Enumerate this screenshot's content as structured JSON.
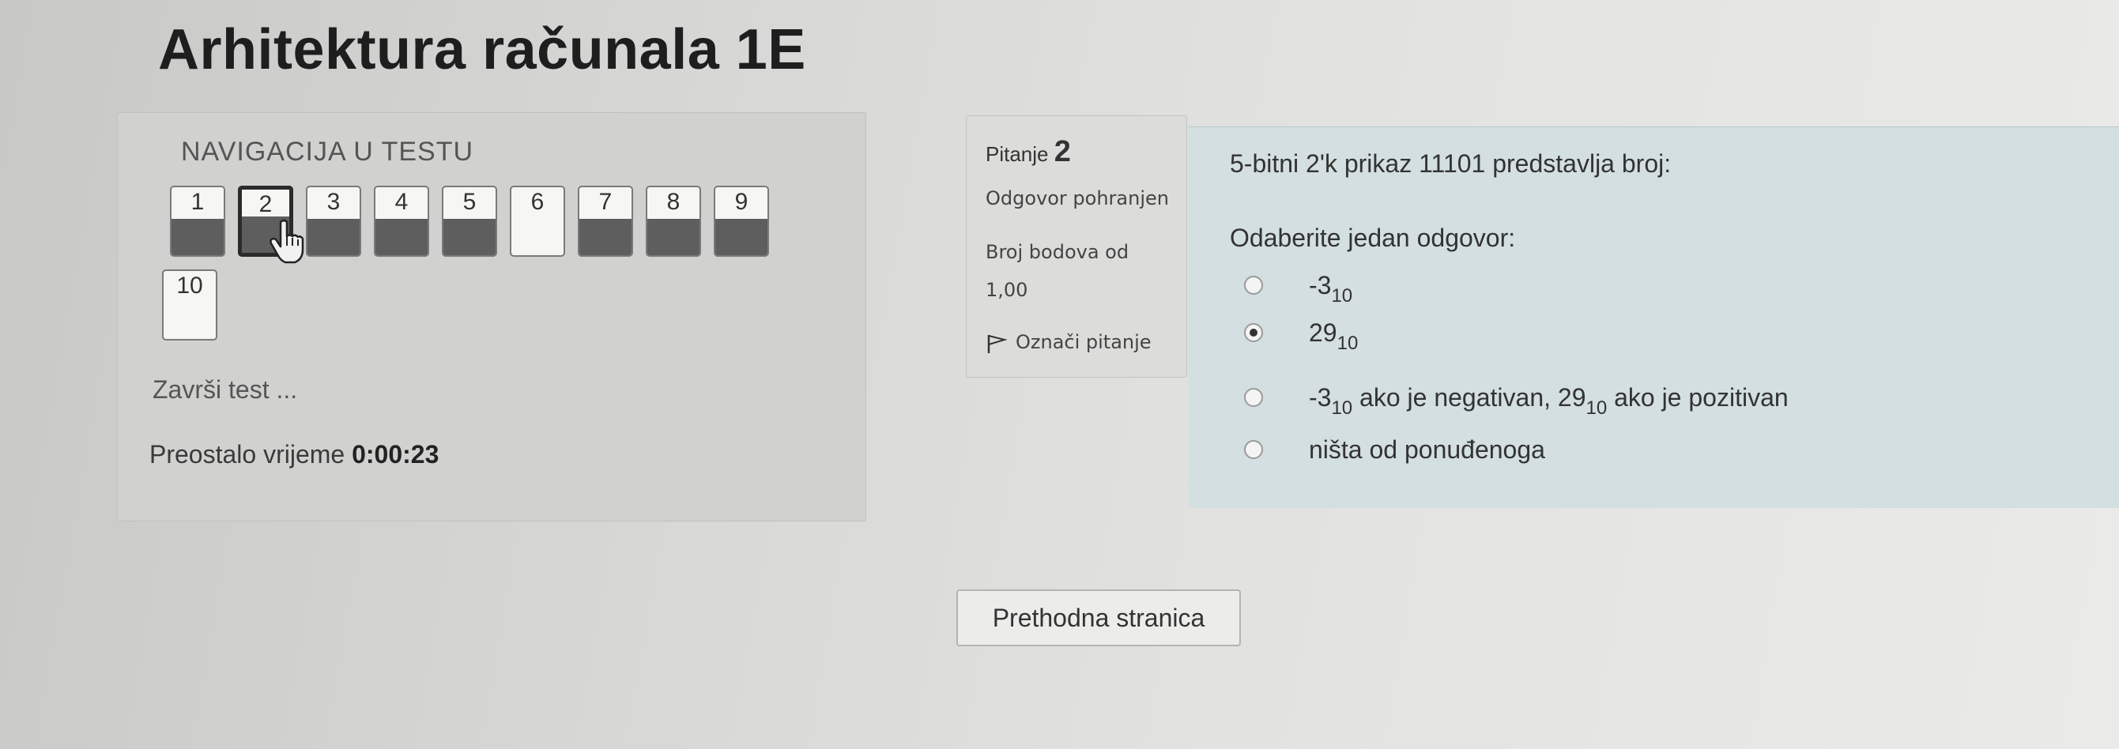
{
  "course": {
    "title": "Arhitektura računala 1E"
  },
  "navigation": {
    "heading": "NAVIGACIJA U TESTU",
    "questions": [
      {
        "label": "1",
        "answered": true,
        "current": false
      },
      {
        "label": "2",
        "answered": true,
        "current": true
      },
      {
        "label": "3",
        "answered": true,
        "current": false
      },
      {
        "label": "4",
        "answered": true,
        "current": false
      },
      {
        "label": "5",
        "answered": true,
        "current": false
      },
      {
        "label": "6",
        "answered": false,
        "current": false
      },
      {
        "label": "7",
        "answered": true,
        "current": false
      },
      {
        "label": "8",
        "answered": true,
        "current": false
      },
      {
        "label": "9",
        "answered": true,
        "current": false
      },
      {
        "label": "10",
        "answered": false,
        "current": false
      }
    ],
    "finish_link": "Završi test ...",
    "time_label": "Preostalo vrijeme",
    "time_value": "0:00:23"
  },
  "question_info": {
    "label": "Pitanje",
    "number": "2",
    "status": "Odgovor pohranjen",
    "points_label": "Broj bodova od",
    "points_value": "1,00",
    "flag_label": "Označi pitanje"
  },
  "question": {
    "text": "5-bitni 2'k prikaz 11101 predstavlja broj:",
    "prompt": "Odaberite jedan odgovor:",
    "options": [
      {
        "main": "-3",
        "sub": "10",
        "rest": "",
        "main2": "",
        "sub2": "",
        "rest2": "",
        "selected": false
      },
      {
        "main": "29",
        "sub": "10",
        "rest": "",
        "main2": "",
        "sub2": "",
        "rest2": "",
        "selected": true
      },
      {
        "main": "-3",
        "sub": "10",
        "rest": " ako je negativan, ",
        "main2": "29",
        "sub2": "10",
        "rest2": " ako je pozitivan",
        "selected": false
      },
      {
        "main": "ništa od ponuđenoga",
        "sub": "",
        "rest": "",
        "main2": "",
        "sub2": "",
        "rest2": "",
        "selected": false
      }
    ]
  },
  "footer": {
    "prev_button": "Prethodna stranica"
  }
}
